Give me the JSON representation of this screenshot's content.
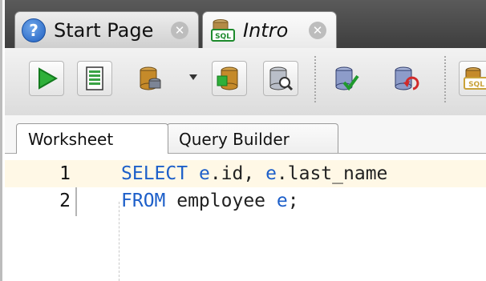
{
  "document_tabs": [
    {
      "label": "Start Page",
      "icon": "help-icon",
      "active": false
    },
    {
      "label": "Intro",
      "icon": "sql-file-icon",
      "active": true
    }
  ],
  "toolbar": {
    "buttons": [
      {
        "name": "run-statement-button",
        "icon": "play-icon"
      },
      {
        "name": "run-script-button",
        "icon": "script-icon"
      },
      {
        "name": "commit-button",
        "icon": "database-icon"
      },
      {
        "name": "autotrace-button",
        "icon": "database-trace-icon"
      },
      {
        "name": "explain-plan-button",
        "icon": "database-search-icon"
      },
      {
        "name": "commit-checked-button",
        "icon": "database-check-icon"
      },
      {
        "name": "rollback-button",
        "icon": "database-undo-icon"
      },
      {
        "name": "sql-history-button",
        "icon": "sql-icon"
      }
    ]
  },
  "editor_tabs": [
    {
      "label": "Worksheet",
      "active": true
    },
    {
      "label": "Query Builder",
      "active": false
    }
  ],
  "editor": {
    "lines": [
      {
        "number": "1",
        "tokens": [
          {
            "text": "SELECT",
            "kw": true
          },
          {
            "text": " ",
            "kw": false
          },
          {
            "text": "e",
            "kw": true
          },
          {
            "text": ".id, ",
            "kw": false
          },
          {
            "text": "e",
            "kw": true
          },
          {
            "text": ".last_name",
            "kw": false
          }
        ]
      },
      {
        "number": "2",
        "tokens": [
          {
            "text": "FROM",
            "kw": true
          },
          {
            "text": " employee ",
            "kw": false
          },
          {
            "text": "e",
            "kw": true
          },
          {
            "text": ";",
            "kw": false
          }
        ]
      }
    ]
  },
  "colors": {
    "keyword": "#1d5fc9",
    "current_line": "#fff8e6",
    "tab_strip": "#4a4a4a"
  }
}
